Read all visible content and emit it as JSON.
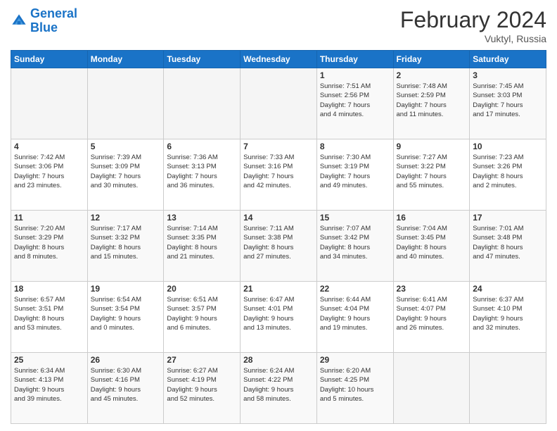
{
  "header": {
    "logo": {
      "line1": "General",
      "line2": "Blue"
    },
    "title": "February 2024",
    "subtitle": "Vuktyl, Russia"
  },
  "weekdays": [
    "Sunday",
    "Monday",
    "Tuesday",
    "Wednesday",
    "Thursday",
    "Friday",
    "Saturday"
  ],
  "weeks": [
    [
      {
        "day": "",
        "info": ""
      },
      {
        "day": "",
        "info": ""
      },
      {
        "day": "",
        "info": ""
      },
      {
        "day": "",
        "info": ""
      },
      {
        "day": "1",
        "info": "Sunrise: 7:51 AM\nSunset: 2:56 PM\nDaylight: 7 hours\nand 4 minutes."
      },
      {
        "day": "2",
        "info": "Sunrise: 7:48 AM\nSunset: 2:59 PM\nDaylight: 7 hours\nand 11 minutes."
      },
      {
        "day": "3",
        "info": "Sunrise: 7:45 AM\nSunset: 3:03 PM\nDaylight: 7 hours\nand 17 minutes."
      }
    ],
    [
      {
        "day": "4",
        "info": "Sunrise: 7:42 AM\nSunset: 3:06 PM\nDaylight: 7 hours\nand 23 minutes."
      },
      {
        "day": "5",
        "info": "Sunrise: 7:39 AM\nSunset: 3:09 PM\nDaylight: 7 hours\nand 30 minutes."
      },
      {
        "day": "6",
        "info": "Sunrise: 7:36 AM\nSunset: 3:13 PM\nDaylight: 7 hours\nand 36 minutes."
      },
      {
        "day": "7",
        "info": "Sunrise: 7:33 AM\nSunset: 3:16 PM\nDaylight: 7 hours\nand 42 minutes."
      },
      {
        "day": "8",
        "info": "Sunrise: 7:30 AM\nSunset: 3:19 PM\nDaylight: 7 hours\nand 49 minutes."
      },
      {
        "day": "9",
        "info": "Sunrise: 7:27 AM\nSunset: 3:22 PM\nDaylight: 7 hours\nand 55 minutes."
      },
      {
        "day": "10",
        "info": "Sunrise: 7:23 AM\nSunset: 3:26 PM\nDaylight: 8 hours\nand 2 minutes."
      }
    ],
    [
      {
        "day": "11",
        "info": "Sunrise: 7:20 AM\nSunset: 3:29 PM\nDaylight: 8 hours\nand 8 minutes."
      },
      {
        "day": "12",
        "info": "Sunrise: 7:17 AM\nSunset: 3:32 PM\nDaylight: 8 hours\nand 15 minutes."
      },
      {
        "day": "13",
        "info": "Sunrise: 7:14 AM\nSunset: 3:35 PM\nDaylight: 8 hours\nand 21 minutes."
      },
      {
        "day": "14",
        "info": "Sunrise: 7:11 AM\nSunset: 3:38 PM\nDaylight: 8 hours\nand 27 minutes."
      },
      {
        "day": "15",
        "info": "Sunrise: 7:07 AM\nSunset: 3:42 PM\nDaylight: 8 hours\nand 34 minutes."
      },
      {
        "day": "16",
        "info": "Sunrise: 7:04 AM\nSunset: 3:45 PM\nDaylight: 8 hours\nand 40 minutes."
      },
      {
        "day": "17",
        "info": "Sunrise: 7:01 AM\nSunset: 3:48 PM\nDaylight: 8 hours\nand 47 minutes."
      }
    ],
    [
      {
        "day": "18",
        "info": "Sunrise: 6:57 AM\nSunset: 3:51 PM\nDaylight: 8 hours\nand 53 minutes."
      },
      {
        "day": "19",
        "info": "Sunrise: 6:54 AM\nSunset: 3:54 PM\nDaylight: 9 hours\nand 0 minutes."
      },
      {
        "day": "20",
        "info": "Sunrise: 6:51 AM\nSunset: 3:57 PM\nDaylight: 9 hours\nand 6 minutes."
      },
      {
        "day": "21",
        "info": "Sunrise: 6:47 AM\nSunset: 4:01 PM\nDaylight: 9 hours\nand 13 minutes."
      },
      {
        "day": "22",
        "info": "Sunrise: 6:44 AM\nSunset: 4:04 PM\nDaylight: 9 hours\nand 19 minutes."
      },
      {
        "day": "23",
        "info": "Sunrise: 6:41 AM\nSunset: 4:07 PM\nDaylight: 9 hours\nand 26 minutes."
      },
      {
        "day": "24",
        "info": "Sunrise: 6:37 AM\nSunset: 4:10 PM\nDaylight: 9 hours\nand 32 minutes."
      }
    ],
    [
      {
        "day": "25",
        "info": "Sunrise: 6:34 AM\nSunset: 4:13 PM\nDaylight: 9 hours\nand 39 minutes."
      },
      {
        "day": "26",
        "info": "Sunrise: 6:30 AM\nSunset: 4:16 PM\nDaylight: 9 hours\nand 45 minutes."
      },
      {
        "day": "27",
        "info": "Sunrise: 6:27 AM\nSunset: 4:19 PM\nDaylight: 9 hours\nand 52 minutes."
      },
      {
        "day": "28",
        "info": "Sunrise: 6:24 AM\nSunset: 4:22 PM\nDaylight: 9 hours\nand 58 minutes."
      },
      {
        "day": "29",
        "info": "Sunrise: 6:20 AM\nSunset: 4:25 PM\nDaylight: 10 hours\nand 5 minutes."
      },
      {
        "day": "",
        "info": ""
      },
      {
        "day": "",
        "info": ""
      }
    ]
  ]
}
